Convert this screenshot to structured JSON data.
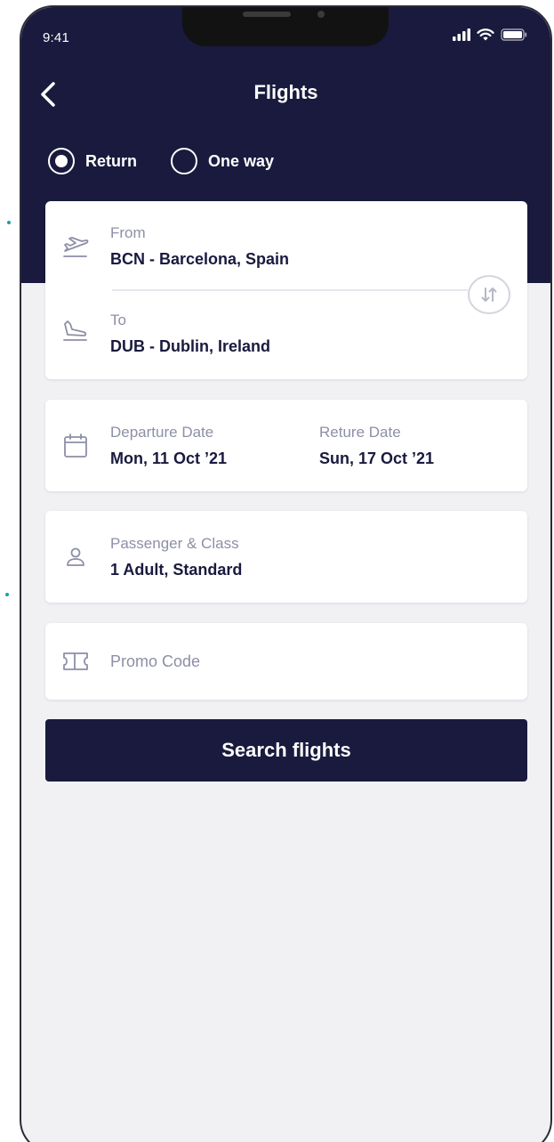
{
  "status_bar": {
    "time": "9:41"
  },
  "header": {
    "title": "Flights"
  },
  "trip_type": {
    "options": [
      {
        "label": "Return",
        "selected": true
      },
      {
        "label": "One way",
        "selected": false
      }
    ]
  },
  "route": {
    "from_label": "From",
    "from_value": "BCN - Barcelona, Spain",
    "to_label": "To",
    "to_value": "DUB - Dublin, Ireland"
  },
  "dates": {
    "departure_label": "Departure Date",
    "departure_value": "Mon, 11 Oct ’21",
    "return_label": "Reture Date",
    "return_value": "Sun, 17 Oct ’21"
  },
  "passenger": {
    "label": "Passenger & Class",
    "value": "1 Adult, Standard"
  },
  "promo": {
    "placeholder": "Promo Code"
  },
  "search_button": {
    "label": "Search flights"
  },
  "colors": {
    "navy": "#191a3e",
    "background": "#f1f1f4",
    "muted_text": "#8d8fa6",
    "accent_teal": "#16a2a6"
  }
}
